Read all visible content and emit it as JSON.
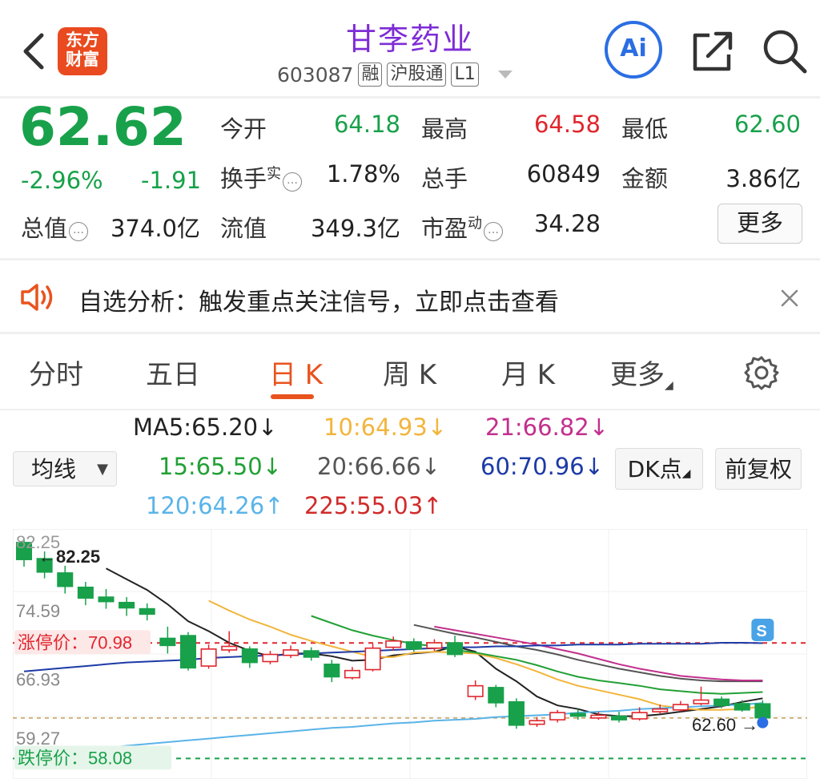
{
  "header": {
    "title": "甘李药业",
    "code": "603087",
    "tags": [
      "融",
      "沪股通",
      "L1"
    ],
    "logo_text": [
      "东方",
      "财富"
    ],
    "ai_label": "Ai",
    "colors": {
      "title": "#7e2cd6",
      "logo": "#ea4a1f",
      "ai": "#2b6ee3"
    }
  },
  "quote": {
    "price": "62.62",
    "change_pct": "-2.96%",
    "change": "-1.91",
    "open_label": "今开",
    "open": "64.18",
    "high_label": "最高",
    "high": "64.58",
    "low_label": "最低",
    "low": "62.60",
    "turnover_label": "换手",
    "turnover_sup": "实",
    "turnover": "1.78%",
    "volume_label": "总手",
    "volume": "60849",
    "amount_label": "金额",
    "amount": "3.86亿",
    "mcap_label": "总值",
    "mcap": "374.0亿",
    "float_label": "流值",
    "float_mcap": "349.3亿",
    "pe_label": "市盈",
    "pe_sup": "动",
    "pe": "34.28",
    "more_label": "更多"
  },
  "notice": {
    "text": "自选分析：触发重点关注信号，立即点击查看"
  },
  "tabs": [
    "分时",
    "五日",
    "日 K",
    "周 K",
    "月 K",
    "更多"
  ],
  "active_tab": "日 K",
  "indicators": {
    "mode_select": "均线",
    "ma5": "MA5:65.20↓",
    "ma10": "10:64.93↓",
    "ma21": "21:66.82↓",
    "ma15": "15:65.50↓",
    "ma20": "20:66.66↓",
    "ma60": "60:70.96↓",
    "ma120": "120:64.26↑",
    "ma225": "225:55.03↑",
    "dk_label": "DK点",
    "adjust_label": "前复权",
    "colors": {
      "ma5": "#222222",
      "ma10": "#f2b53c",
      "ma21": "#c2308d",
      "ma15": "#22a035",
      "ma20": "#555555",
      "ma60": "#1d3aa6",
      "ma120": "#5ab4e8",
      "ma225": "#d12b2b"
    }
  },
  "chart_labels": {
    "top_left": "82.25",
    "max_marker": "←82.25",
    "y1": "74.59",
    "limit_up": "涨停价：70.98",
    "y2": "66.93",
    "y3": "59.27",
    "limit_down": "跌停价：58.08",
    "last_low": "62.60 →",
    "signal_s": "S"
  },
  "chart_data": {
    "type": "candlestick",
    "y_range": [
      56.5,
      83.0
    ],
    "candles": [
      {
        "o": 82.2,
        "c": 80.3,
        "h": 82.6,
        "l": 79.5
      },
      {
        "o": 80.4,
        "c": 78.9,
        "h": 81.2,
        "l": 78.2
      },
      {
        "o": 78.8,
        "c": 77.3,
        "h": 79.6,
        "l": 76.5
      },
      {
        "o": 77.2,
        "c": 76.0,
        "h": 77.8,
        "l": 75.2
      },
      {
        "o": 76.1,
        "c": 75.6,
        "h": 77.0,
        "l": 74.8
      },
      {
        "o": 75.5,
        "c": 74.9,
        "h": 76.1,
        "l": 74.0
      },
      {
        "o": 74.8,
        "c": 74.2,
        "h": 75.4,
        "l": 73.5
      },
      {
        "o": 71.5,
        "c": 70.7,
        "h": 72.8,
        "l": 69.8
      },
      {
        "o": 71.8,
        "c": 68.2,
        "h": 72.2,
        "l": 67.9
      },
      {
        "o": 68.4,
        "c": 70.3,
        "h": 70.8,
        "l": 68.1
      },
      {
        "o": 70.2,
        "c": 70.6,
        "h": 72.3,
        "l": 69.9
      },
      {
        "o": 70.3,
        "c": 68.8,
        "h": 70.6,
        "l": 68.2
      },
      {
        "o": 68.9,
        "c": 69.7,
        "h": 70.1,
        "l": 68.6
      },
      {
        "o": 69.6,
        "c": 70.2,
        "h": 70.7,
        "l": 69.3
      },
      {
        "o": 70.1,
        "c": 69.4,
        "h": 70.5,
        "l": 69.0
      },
      {
        "o": 68.6,
        "c": 67.2,
        "h": 69.1,
        "l": 66.6
      },
      {
        "o": 67.1,
        "c": 67.9,
        "h": 68.3,
        "l": 66.9
      },
      {
        "o": 68.0,
        "c": 70.4,
        "h": 70.9,
        "l": 67.8
      },
      {
        "o": 70.5,
        "c": 71.2,
        "h": 71.7,
        "l": 70.1
      },
      {
        "o": 71.1,
        "c": 70.3,
        "h": 71.5,
        "l": 70.0
      },
      {
        "o": 70.4,
        "c": 71.0,
        "h": 71.4,
        "l": 70.1
      },
      {
        "o": 71.0,
        "c": 69.7,
        "h": 71.8,
        "l": 69.4
      },
      {
        "o": 65.0,
        "c": 66.2,
        "h": 66.8,
        "l": 64.6
      },
      {
        "o": 66.0,
        "c": 64.3,
        "h": 66.3,
        "l": 63.8
      },
      {
        "o": 64.4,
        "c": 61.8,
        "h": 64.8,
        "l": 61.4
      },
      {
        "o": 61.9,
        "c": 62.3,
        "h": 62.7,
        "l": 61.6
      },
      {
        "o": 62.4,
        "c": 63.2,
        "h": 63.5,
        "l": 62.1
      },
      {
        "o": 63.1,
        "c": 62.8,
        "h": 63.6,
        "l": 62.4
      },
      {
        "o": 62.6,
        "c": 62.9,
        "h": 63.3,
        "l": 62.4
      },
      {
        "o": 62.8,
        "c": 62.4,
        "h": 63.3,
        "l": 62.1
      },
      {
        "o": 62.5,
        "c": 63.2,
        "h": 63.8,
        "l": 62.3
      },
      {
        "o": 63.3,
        "c": 63.6,
        "h": 64.1,
        "l": 63.1
      },
      {
        "o": 63.5,
        "c": 64.1,
        "h": 64.5,
        "l": 63.3
      },
      {
        "o": 64.2,
        "c": 64.6,
        "h": 66.1,
        "l": 64.0
      },
      {
        "o": 64.7,
        "c": 64.0,
        "h": 65.0,
        "l": 63.7
      },
      {
        "o": 64.2,
        "c": 63.5,
        "h": 64.6,
        "l": 63.3
      },
      {
        "o": 64.18,
        "c": 62.62,
        "h": 64.58,
        "l": 62.6
      }
    ],
    "ma_series": [
      {
        "key": "ma5",
        "values": [
          null,
          null,
          null,
          null,
          79.3,
          78.1,
          76.9,
          75.3,
          73.4,
          72.3,
          71.0,
          70.1,
          69.5,
          69.8,
          69.8,
          69.5,
          69.0,
          69.1,
          69.6,
          69.8,
          70.0,
          70.6,
          70.0,
          68.1,
          66.7,
          65.0,
          64.0,
          63.6,
          63.0,
          62.8,
          62.8,
          63.0,
          63.3,
          63.6,
          63.9,
          64.4,
          64.8
        ]
      },
      {
        "key": "ma10",
        "values": [
          null,
          null,
          null,
          null,
          null,
          null,
          null,
          null,
          null,
          75.7,
          74.6,
          73.6,
          72.8,
          71.9,
          71.2,
          70.6,
          70.0,
          69.4,
          69.4,
          69.9,
          70.0,
          69.9,
          69.8,
          69.3,
          68.6,
          67.8,
          66.9,
          66.2,
          65.7,
          65.2,
          64.7,
          64.0,
          63.7,
          63.5,
          63.5,
          63.6,
          63.9
        ]
      },
      {
        "key": "ma15",
        "values": [
          null,
          null,
          null,
          null,
          null,
          null,
          null,
          null,
          null,
          null,
          null,
          null,
          null,
          null,
          74.0,
          73.2,
          72.4,
          71.8,
          71.3,
          70.9,
          70.6,
          70.2,
          69.9,
          69.5,
          69.1,
          68.5,
          67.8,
          67.2,
          66.8,
          66.5,
          66.2,
          65.8,
          65.6,
          65.4,
          65.3,
          65.4,
          65.5
        ]
      },
      {
        "key": "ma20",
        "values": [
          null,
          null,
          null,
          null,
          null,
          null,
          null,
          null,
          null,
          null,
          null,
          null,
          null,
          null,
          null,
          null,
          null,
          null,
          null,
          73.0,
          72.5,
          72.0,
          71.6,
          71.1,
          70.6,
          70.2,
          69.7,
          69.1,
          68.6,
          68.1,
          67.7,
          67.3,
          67.0,
          66.8,
          66.7,
          66.7,
          66.7
        ]
      },
      {
        "key": "ma21",
        "values": [
          null,
          null,
          null,
          null,
          null,
          null,
          null,
          null,
          null,
          null,
          null,
          null,
          null,
          null,
          null,
          null,
          null,
          null,
          null,
          null,
          72.8,
          72.4,
          72.0,
          71.6,
          71.2,
          70.8,
          70.3,
          69.8,
          69.2,
          68.6,
          68.1,
          67.7,
          67.3,
          67.1,
          66.9,
          66.8,
          66.8
        ]
      },
      {
        "key": "ma60",
        "values": [
          67.8,
          68.0,
          68.2,
          68.4,
          68.6,
          68.8,
          68.9,
          69.0,
          69.1,
          69.3,
          69.4,
          69.5,
          69.6,
          69.7,
          69.8,
          69.9,
          70.0,
          70.1,
          70.2,
          70.3,
          70.4,
          70.5,
          70.5,
          70.6,
          70.6,
          70.7,
          70.7,
          70.8,
          70.8,
          70.8,
          70.9,
          70.9,
          70.9,
          70.9,
          71.0,
          71.0,
          70.96
        ]
      },
      {
        "key": "ma120",
        "values": [
          58.4,
          58.6,
          58.8,
          59.0,
          59.2,
          59.5,
          59.7,
          59.9,
          60.1,
          60.3,
          60.5,
          60.7,
          60.9,
          61.1,
          61.3,
          61.5,
          61.6,
          61.8,
          62.0,
          62.1,
          62.3,
          62.4,
          62.5,
          62.7,
          62.8,
          62.9,
          63.0,
          63.2,
          63.3,
          63.4,
          63.6,
          63.7,
          63.8,
          63.9,
          64.0,
          64.1,
          64.26
        ]
      }
    ],
    "limit_up": 70.98,
    "limit_down": 58.08
  }
}
